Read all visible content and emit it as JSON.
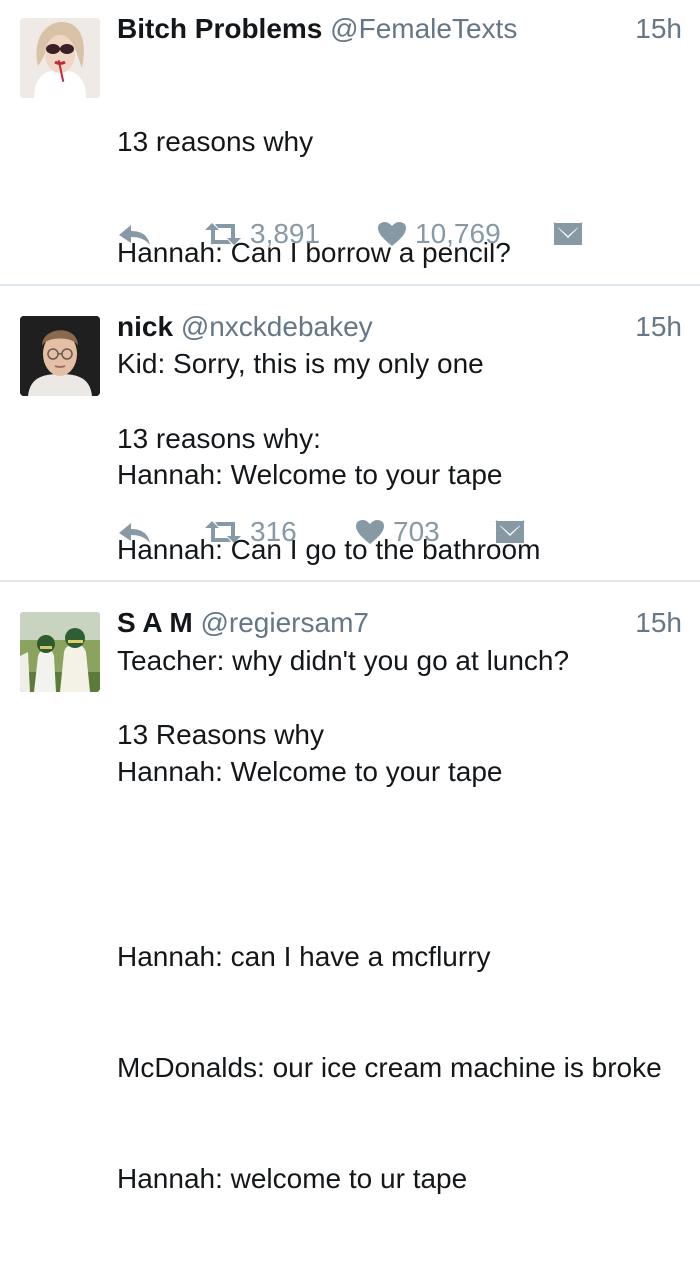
{
  "tweets": [
    {
      "name": "Bitch Problems",
      "handle": "@FemaleTexts",
      "time": "15h",
      "lines": [
        "13 reasons why",
        "Hannah: Can I borrow a pencil?",
        "Kid: Sorry, this is my only one",
        "Hannah: Welcome to your tape"
      ],
      "retweets": "3,891",
      "likes": "10,769"
    },
    {
      "name": "nick",
      "handle": "@nxckdebakey",
      "time": "15h",
      "lines": [
        "13 reasons why:",
        "Hannah: Can I go to the bathroom",
        "Teacher: why didn't you go at lunch?",
        "Hannah: Welcome to your tape"
      ],
      "retweets": "316",
      "likes": "703"
    },
    {
      "name": "S A M",
      "handle": "@regiersam7",
      "time": "15h",
      "lines": [
        "13 Reasons why",
        "",
        "Hannah: can I have a mcflurry",
        "McDonalds: our ice cream machine is broke",
        "Hannah: welcome to ur tape"
      ]
    }
  ],
  "icons": {
    "reply": "reply-icon",
    "retweet": "retweet-icon",
    "like": "heart-icon",
    "dm": "direct-message-icon"
  },
  "colors": {
    "text": "#14171a",
    "secondary": "#657786",
    "action": "#8899a6",
    "divider": "#e1e8ed"
  }
}
